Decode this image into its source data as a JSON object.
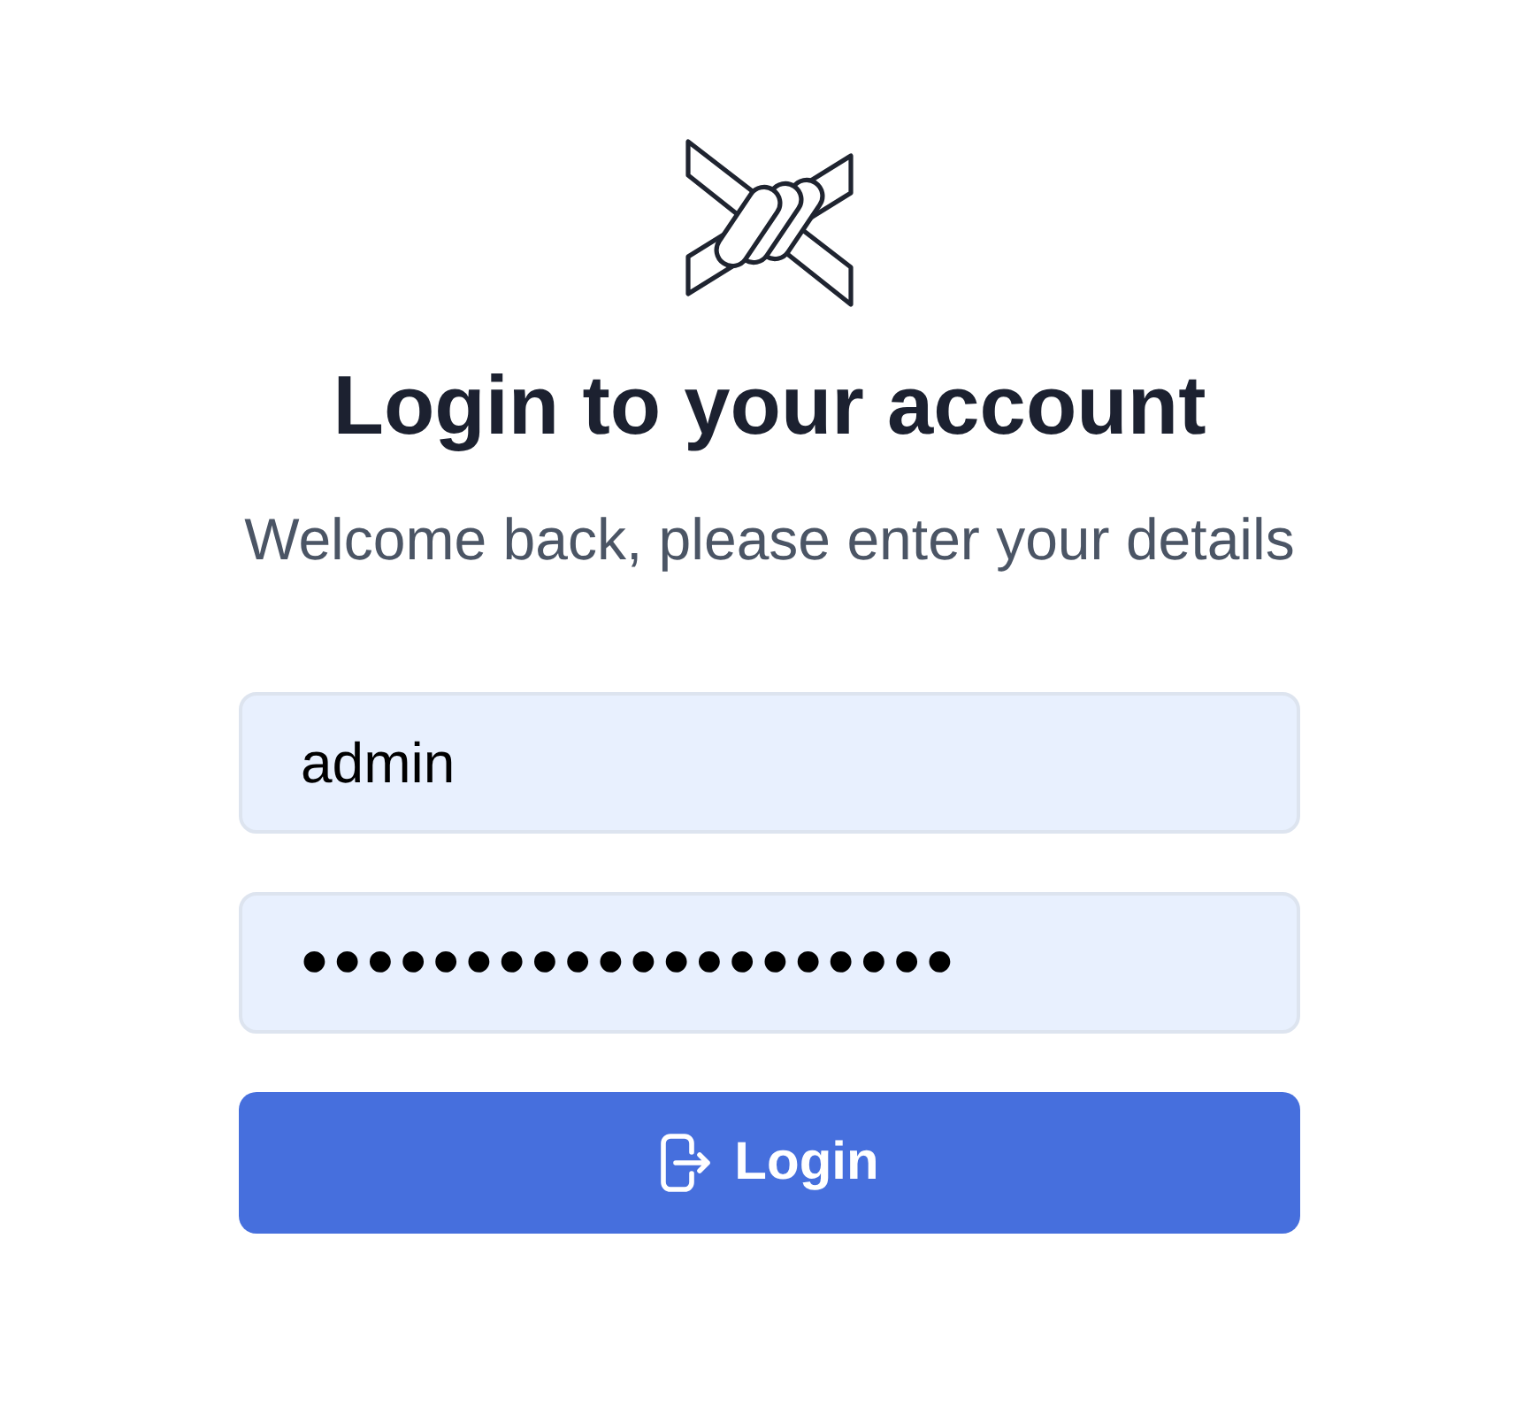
{
  "heading": "Login to your account",
  "subheading": "Welcome back, please enter your details",
  "fields": [
    {
      "kind": "text",
      "value": "admin"
    },
    {
      "kind": "password",
      "value": "••••••••••••••••••••"
    }
  ],
  "submit_button": {
    "label": "Login"
  }
}
